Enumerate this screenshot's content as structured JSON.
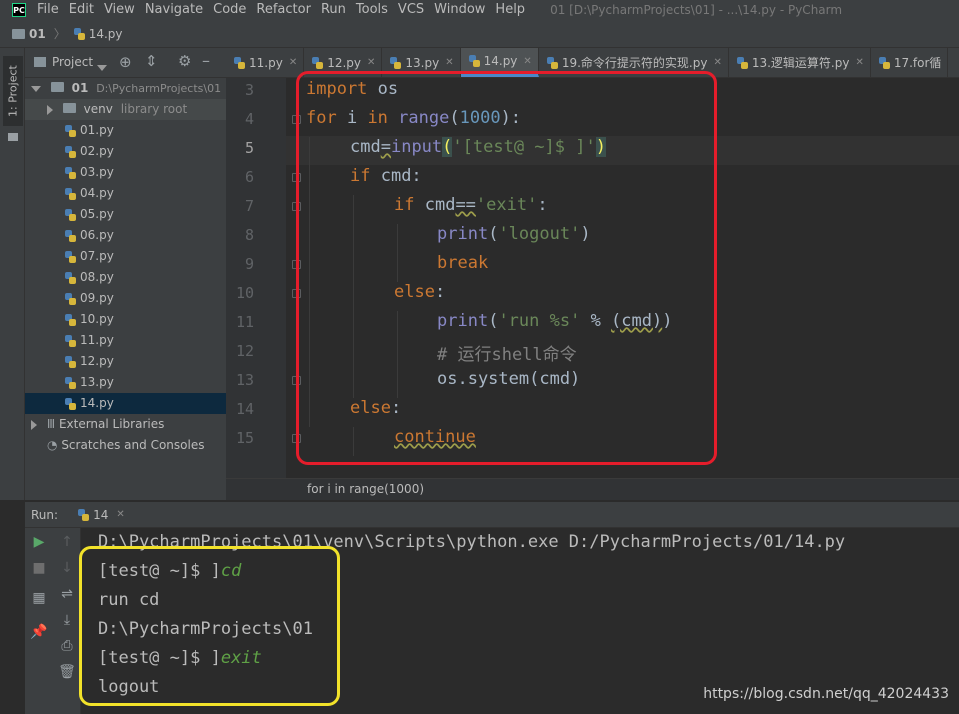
{
  "menu": {
    "items": [
      "File",
      "Edit",
      "View",
      "Navigate",
      "Code",
      "Refactor",
      "Run",
      "Tools",
      "VCS",
      "Window",
      "Help"
    ],
    "window_title": "01 [D:\\PycharmProjects\\01] - ...\\14.py - PyCharm"
  },
  "navbar": {
    "folder": "01",
    "file": "14.py"
  },
  "left_strip": {
    "project_tab": "1: Project"
  },
  "project": {
    "header_label": "Project",
    "root_name": "01",
    "root_path": "D:\\PycharmProjects\\01",
    "venv_name": "venv",
    "venv_tag": "library root",
    "files": [
      "01.py",
      "02.py",
      "03.py",
      "04.py",
      "05.py",
      "06.py",
      "07.py",
      "08.py",
      "09.py",
      "10.py",
      "11.py",
      "12.py",
      "13.py",
      "14.py"
    ],
    "external_libraries": "External Libraries",
    "scratches": "Scratches and Consoles"
  },
  "tabs": [
    "11.py",
    "12.py",
    "13.py",
    "14.py",
    "19.命令行提示符的实现.py",
    "13.逻辑运算符.py",
    "17.for循"
  ],
  "editor": {
    "line_numbers": [
      "3",
      "4",
      "5",
      "6",
      "7",
      "8",
      "9",
      "10",
      "11",
      "12",
      "13",
      "14",
      "15"
    ],
    "l3": {
      "kw": "import",
      "rest": " os"
    },
    "l4": {
      "kw1": "for",
      "a": " i ",
      "kw2": "in",
      "sp": " ",
      "bi": "range",
      "p1": "(",
      "num": "1000",
      "p2": "):"
    },
    "l5": {
      "a": "cmd",
      "eq": "=",
      "bi": "input",
      "p1": "(",
      "str": "'[test@ ~]$ ]'",
      "p2": ")"
    },
    "l6": {
      "kw": "if",
      "rest": " cmd:"
    },
    "l7": {
      "kw": "if",
      "a": " cmd",
      "eq": "==",
      "str": "'exit'",
      "p": ":"
    },
    "l8": {
      "bi": "print",
      "p1": "(",
      "str": "'logout'",
      "p2": ")"
    },
    "l9": {
      "kw": "break"
    },
    "l10": {
      "kw": "else",
      "p": ":"
    },
    "l11": {
      "bi": "print",
      "p1": "(",
      "str": "'run %s'",
      "mid": " % ",
      "u": "(cmd)",
      "p2": ")"
    },
    "l12": {
      "cmt": "# 运行shell命令"
    },
    "l13": {
      "code": "os.system(cmd)"
    },
    "l14": {
      "kw": "else",
      "p": ":"
    },
    "l15": {
      "kw": "continue"
    },
    "breadcrumb": "for i in range(1000)"
  },
  "run": {
    "label": "Run:",
    "tab": "14",
    "lines": [
      {
        "text": "D:\\PycharmProjects\\01\\venv\\Scripts\\python.exe D:/PycharmProjects/01/14.py",
        "input": ""
      },
      {
        "text": "[test@ ~]$ ]",
        "input": "cd"
      },
      {
        "text": "run cd",
        "input": ""
      },
      {
        "text": "D:\\PycharmProjects\\01",
        "input": ""
      },
      {
        "text": "[test@ ~]$ ]",
        "input": "exit"
      },
      {
        "text": "logout",
        "input": ""
      }
    ]
  },
  "watermark": "https://blog.csdn.net/qq_42024433",
  "colors": {
    "annotation_red": "#e51d2b",
    "annotation_yellow": "#f2e22a",
    "keyword": "#cc7832",
    "string": "#6a8759",
    "number": "#6897bb",
    "builtin": "#8888c6"
  }
}
